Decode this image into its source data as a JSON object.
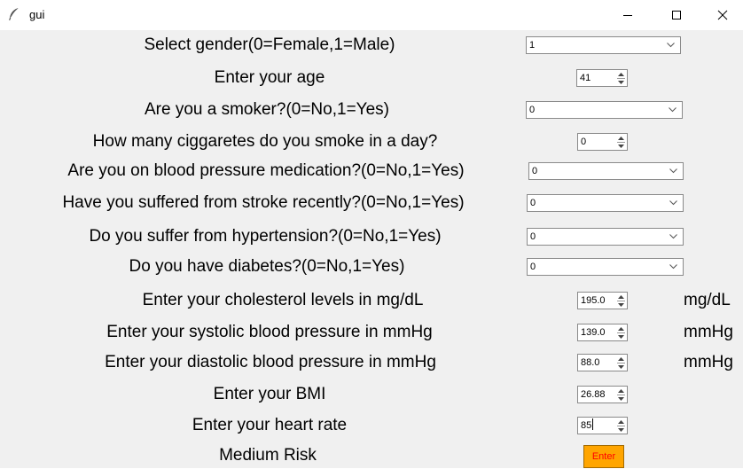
{
  "window": {
    "title": "gui",
    "icon": "feather-icon",
    "controls": [
      "minimize-icon",
      "maximize-icon",
      "close-icon"
    ]
  },
  "form": {
    "gender": {
      "label": "Select gender(0=Female,1=Male)",
      "value": "1"
    },
    "age": {
      "label": "Enter your age",
      "value": "41"
    },
    "smoker": {
      "label": "Are you a smoker?(0=No,1=Yes)",
      "value": "0"
    },
    "cigs_per_day": {
      "label": "How many ciggaretes do you smoke in a day?",
      "value": "0"
    },
    "bp_meds": {
      "label": "Are you on blood pressure medication?(0=No,1=Yes)",
      "value": "0"
    },
    "stroke": {
      "label": "Have you suffered from stroke recently?(0=No,1=Yes)",
      "value": "0"
    },
    "hypertension": {
      "label": "Do you suffer from hypertension?(0=No,1=Yes)",
      "value": "0"
    },
    "diabetes": {
      "label": "Do you have diabetes?(0=No,1=Yes)",
      "value": "0"
    },
    "cholesterol": {
      "label": "Enter your cholesterol levels in mg/dL",
      "value": "195.0",
      "unit": "mg/dL"
    },
    "systolic": {
      "label": "Enter your systolic blood pressure in mmHg",
      "value": "139.0",
      "unit": "mmHg"
    },
    "diastolic": {
      "label": "Enter your diastolic blood pressure in mmHg",
      "value": "88.0",
      "unit": "mmHg"
    },
    "bmi": {
      "label": "Enter your BMI",
      "value": "26.88"
    },
    "heart_rate": {
      "label": "Enter your heart rate",
      "value": "85"
    }
  },
  "result": {
    "text": "Medium Risk"
  },
  "enter_button": {
    "label": "Enter"
  },
  "colors": {
    "window_bg": "#f0f0f0",
    "titlebar_bg": "#ffffff",
    "button_bg": "#ffa500",
    "button_text": "#ff0000"
  }
}
